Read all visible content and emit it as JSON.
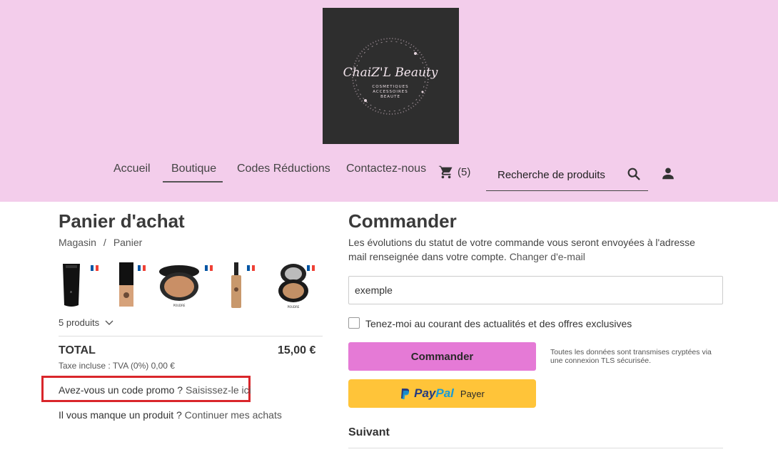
{
  "logo": {
    "brand": "ChaiZ'L Beauty",
    "tagline_lines": [
      "COSMETIQUES",
      "ACCESSOIRES",
      "BEAUTE"
    ]
  },
  "nav": {
    "items": [
      {
        "label": "Accueil",
        "active": false
      },
      {
        "label": "Boutique",
        "active": true
      },
      {
        "label": "Codes Réductions",
        "active": false
      },
      {
        "label": "Contactez-nous",
        "active": false
      }
    ],
    "cart_count": "(5)",
    "cart_icon": "cart-icon",
    "search_placeholder": "Recherche de produits",
    "search_icon": "search-icon",
    "account_icon": "user-icon"
  },
  "cart": {
    "title": "Panier d'achat",
    "breadcrumb": [
      "Magasin",
      "Panier"
    ],
    "thumbnails": [
      "foundation-tube",
      "foundation-bottle",
      "compact-powder",
      "serum-dropper-bottle",
      "compact-powder-open"
    ],
    "products_count_label": "5 produits",
    "total_label": "TOTAL",
    "total_value": "15,00 €",
    "tax_label": "Taxe incluse : TVA (0%) 0,00 €",
    "promo_question": "Avez-vous un code promo ?",
    "promo_link": "Saisissez-le ici",
    "missing_question": "Il vous manque un produit ?",
    "missing_link": "Continuer mes achats"
  },
  "checkout": {
    "title": "Commander",
    "desc": "Les évolutions du statut de votre commande vous seront envoyées à l'adresse mail renseignée dans votre compte.",
    "change_email_link": "Changer d'e-mail",
    "email_value": "exemple",
    "newsletter_label": "Tenez-moi au courant des actualités et des offres exclusives",
    "newsletter_checked": false,
    "order_button": "Commander",
    "secure_note": "Toutes les données sont transmises cryptées via une connexion TLS sécurisée.",
    "paypal_pay": "Pay",
    "paypal_pal": "Pal",
    "paypal_payer": "Payer",
    "next_label": "Suivant"
  },
  "colors": {
    "header_bg": "#f3cdeb",
    "accent_button": "#e57ad6",
    "paypal_yellow": "#ffc439",
    "highlight_red": "#d9262b"
  }
}
